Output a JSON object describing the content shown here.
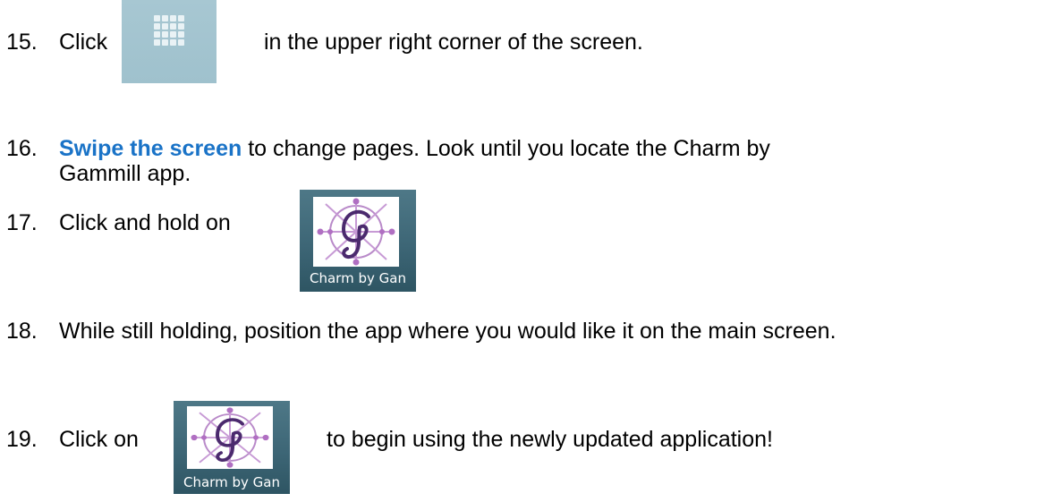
{
  "steps": [
    {
      "num": "15.",
      "before": "Click",
      "after": "in the upper right corner of the screen."
    },
    {
      "num": "16.",
      "emph": "Swipe the screen",
      "line1": " to change pages.  Look until you locate the Charm by",
      "line2": "Gammill app."
    },
    {
      "num": "17.",
      "text": "Click and hold on"
    },
    {
      "num": "18.",
      "text": "While still holding, position the app where you would like it on the main screen."
    },
    {
      "num": "19.",
      "before": "Click on",
      "after": "to begin using the newly updated application!"
    }
  ],
  "app_icon": {
    "label": "Charm by Gan",
    "icon": "charm-by-gammill-app-icon"
  },
  "grid_icon": {
    "icon": "app-grid-icon"
  },
  "colors": {
    "emphasis": "#1a73c7",
    "icon_bg": "#3d6676",
    "grid_bg": "#a7c7d2"
  }
}
